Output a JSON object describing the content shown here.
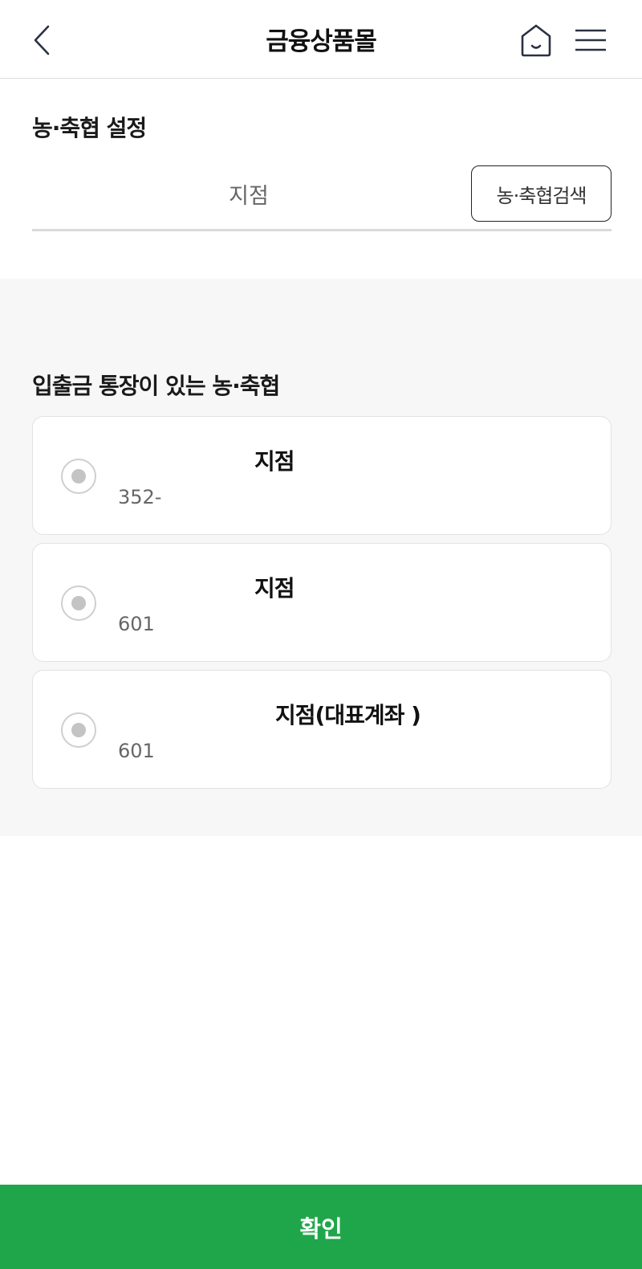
{
  "header": {
    "title": "금융상품몰",
    "back_icon": "chevron-left-icon",
    "home_icon": "home-icon",
    "menu_icon": "hamburger-menu-icon"
  },
  "settings": {
    "title": "농·축협 설정",
    "branch_value": "지점",
    "search_button": "농·축협검색"
  },
  "account_list": {
    "title": "입출금 통장이 있는 농·축협",
    "items": [
      {
        "name": "지점",
        "account": "352-"
      },
      {
        "name": "지점",
        "account": "601"
      },
      {
        "name": "지점(대표계좌 )",
        "account": "601"
      }
    ]
  },
  "confirm_button": "확인",
  "colors": {
    "accent": "#1fa64a",
    "gray_bg": "#f7f7f7",
    "radio": "#c4c4c4"
  }
}
